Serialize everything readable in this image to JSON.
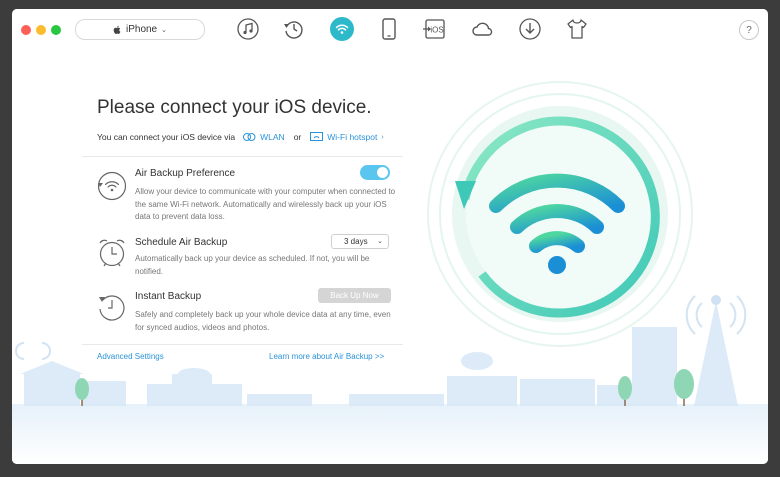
{
  "window": {
    "device_name": "iPhone",
    "help_label": "?"
  },
  "toolbar": {
    "icons": [
      "music-icon",
      "history-icon",
      "wifi-icon",
      "phone-icon",
      "ios-icon",
      "cloud-icon",
      "download-icon",
      "tshirt-icon"
    ],
    "active": "wifi-icon",
    "ios_label": "iOS"
  },
  "main": {
    "title": "Please connect your iOS device.",
    "subtitle_prefix": "You can connect your iOS device via",
    "wlan_label": "WLAN",
    "or_label": "or",
    "hotspot_label": "Wi-Fi hotspot",
    "air_backup": {
      "title": "Air Backup Preference",
      "desc": "Allow your device to communicate with your computer when connected to the same Wi-Fi network. Automatically and wirelessly back up your iOS data to prevent data loss.",
      "enabled": true
    },
    "schedule": {
      "title": "Schedule Air Backup",
      "desc": "Automatically back up your device as scheduled. If not, you will be notified.",
      "interval": "3 days"
    },
    "instant": {
      "title": "Instant Backup",
      "desc": "Safely and completely back up your whole device data at any time, even for synced audios, videos and photos.",
      "button_label": "Back Up Now"
    },
    "advanced_link": "Advanced Settings",
    "learn_more_link": "Learn more about Air Backup >>"
  },
  "colors": {
    "accent": "#2b93d9",
    "teal": "#2db9c9",
    "toggle": "#5ac6ef"
  }
}
